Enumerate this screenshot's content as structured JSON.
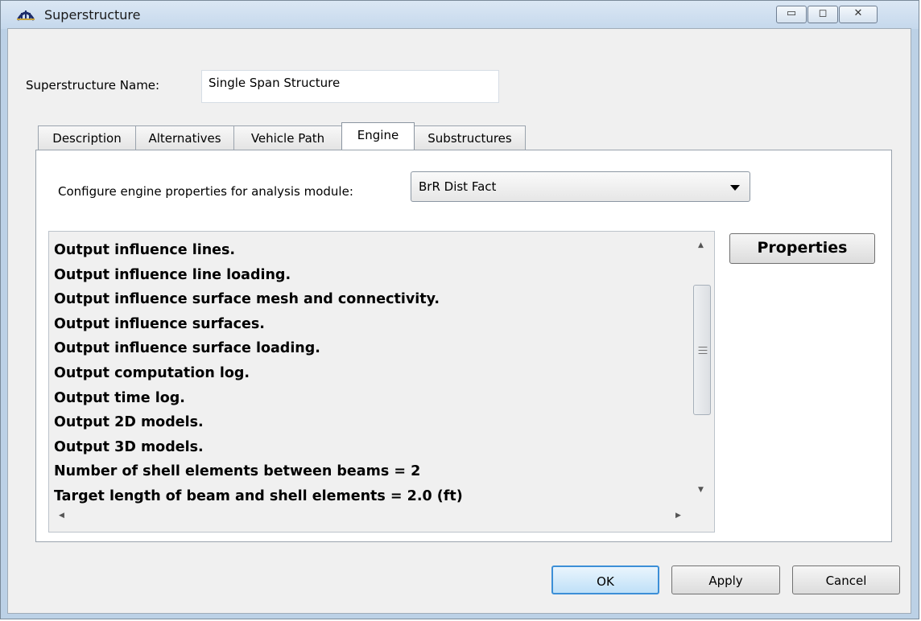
{
  "window": {
    "title": "Superstructure",
    "controls": {
      "minimize": "▭",
      "maximize": "◻",
      "close": "✕"
    }
  },
  "form": {
    "name_label": "Superstructure Name:",
    "name_value": "Single Span Structure"
  },
  "tabs": [
    {
      "label": "Description",
      "active": false
    },
    {
      "label": "Alternatives",
      "active": false
    },
    {
      "label": "Vehicle Path",
      "active": false
    },
    {
      "label": "Engine",
      "active": true
    },
    {
      "label": "Substructures",
      "active": false
    }
  ],
  "engine": {
    "config_label": "Configure engine properties for analysis module:",
    "module_selected": "BrR Dist Fact",
    "properties_lines": [
      "Output influence lines.",
      "Output influence line loading.",
      "Output influence surface mesh and connectivity.",
      "Output influence surfaces.",
      "Output influence surface loading.",
      "Output computation log.",
      "Output time log.",
      "Output 2D models.",
      "Output 3D models.",
      "Number of shell elements between beams = 2",
      "Target length of beam and shell elements = 2.0 (ft)"
    ],
    "properties_button": "Properties"
  },
  "buttons": {
    "ok": "OK",
    "apply": "Apply",
    "cancel": "Cancel"
  },
  "icons": {
    "app": "bridge-icon"
  }
}
